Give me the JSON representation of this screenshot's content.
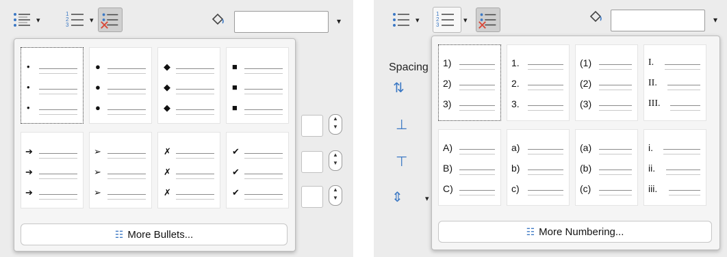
{
  "left": {
    "toolbar": {
      "bullets_caret": "▾",
      "numbering_caret": "▾",
      "combo_caret": "▾"
    },
    "popup": {
      "cells": [
        {
          "mark": "•"
        },
        {
          "mark": "●"
        },
        {
          "mark": "◆"
        },
        {
          "mark": "■"
        },
        {
          "mark": "➔"
        },
        {
          "mark": "➢"
        },
        {
          "mark": "✗"
        },
        {
          "mark": "✔"
        }
      ],
      "more_label": "More Bullets..."
    }
  },
  "right": {
    "toolbar": {
      "bullets_caret": "▾",
      "numbering_caret": "▾",
      "combo_caret": "▾"
    },
    "side": {
      "spacing_label": "Spacing"
    },
    "popup": {
      "cells": [
        {
          "marks": [
            "1)",
            "2)",
            "3)"
          ],
          "font": "num"
        },
        {
          "marks": [
            "1.",
            "2.",
            "3."
          ],
          "font": "num"
        },
        {
          "marks": [
            "(1)",
            "(2)",
            "(3)"
          ],
          "font": "num"
        },
        {
          "marks": [
            "I.",
            "II.",
            "III."
          ],
          "font": "roman"
        },
        {
          "marks": [
            "A)",
            "B)",
            "C)"
          ],
          "font": "num"
        },
        {
          "marks": [
            "a)",
            "b)",
            "c)"
          ],
          "font": "num"
        },
        {
          "marks": [
            "(a)",
            "(b)",
            "(c)"
          ],
          "font": "num"
        },
        {
          "marks": [
            "i.",
            "ii.",
            "iii."
          ],
          "font": "num"
        }
      ],
      "more_label": "More Numbering..."
    }
  },
  "colors": {
    "accent_blue": "#3b78c4",
    "remove_red": "#d84a3a",
    "panel_bg": "#ececec"
  }
}
